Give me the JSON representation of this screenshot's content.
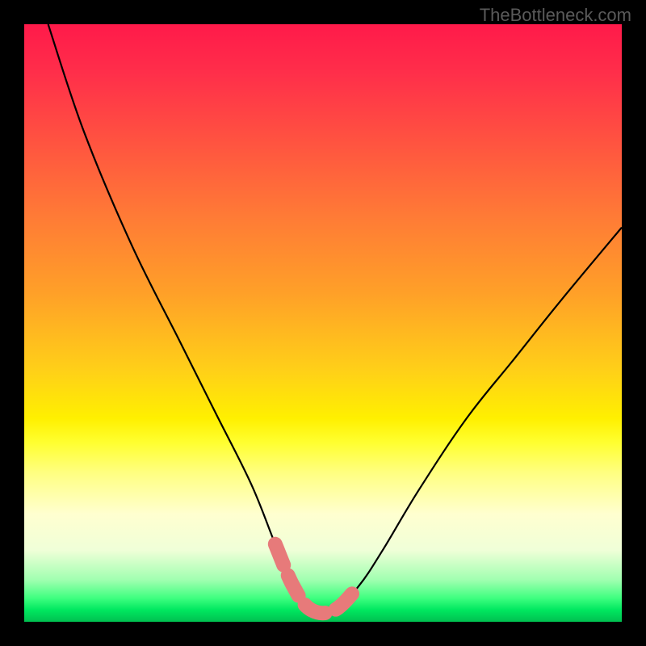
{
  "watermark": "TheBottleneck.com",
  "chart_data": {
    "type": "line",
    "title": "",
    "xlabel": "",
    "ylabel": "",
    "xlim": [
      0,
      100
    ],
    "ylim": [
      0,
      100
    ],
    "background_gradient_meaning": "red (high bottleneck) to green (low bottleneck)",
    "series": [
      {
        "name": "bottleneck-curve",
        "x": [
          4,
          10,
          18,
          26,
          32,
          38,
          42,
          45,
          48,
          52,
          56,
          60,
          66,
          74,
          82,
          90,
          100
        ],
        "values": [
          100,
          82,
          63,
          47,
          35,
          23,
          13,
          6,
          2,
          2,
          6,
          12,
          22,
          34,
          44,
          54,
          66
        ]
      }
    ],
    "highlight": {
      "name": "bottom-marker",
      "color": "#e77a7a",
      "points_x": [
        42,
        45,
        48,
        52,
        56
      ],
      "points_y": [
        13,
        6,
        2,
        2,
        6
      ]
    }
  }
}
